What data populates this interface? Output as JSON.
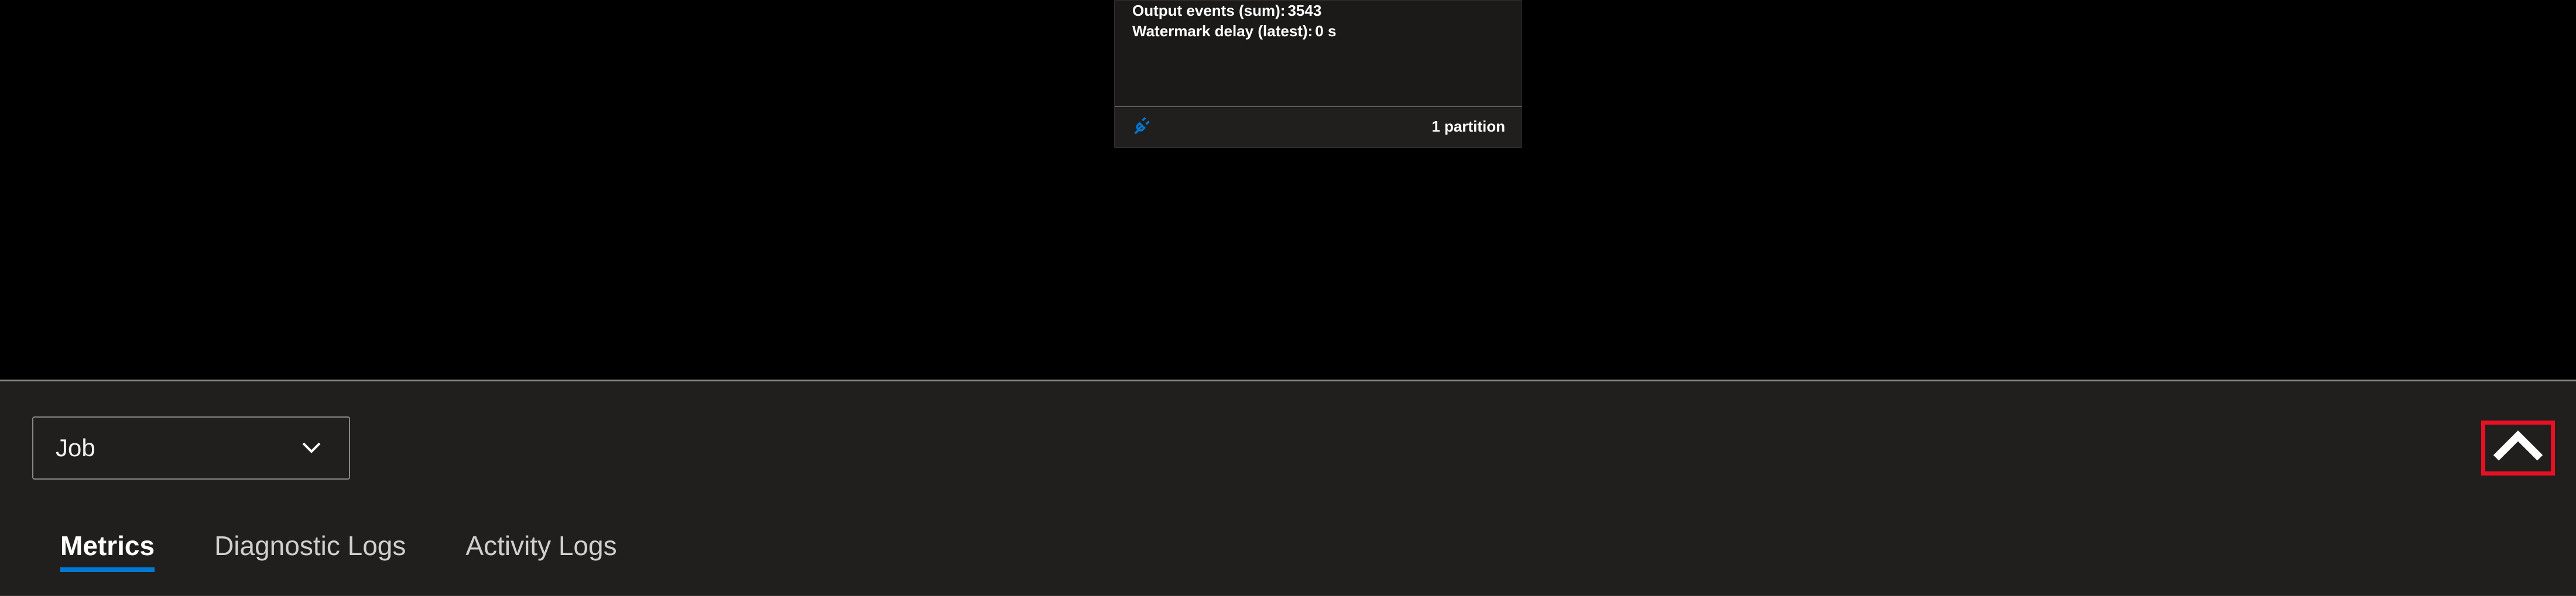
{
  "node": {
    "stats": [
      {
        "label": "Output events (sum):",
        "value": "3543"
      },
      {
        "label": "Watermark delay (latest):",
        "value": "0 s"
      }
    ],
    "footer_text": "1 partition"
  },
  "panel": {
    "select_value": "Job",
    "tabs": [
      {
        "label": "Metrics",
        "active": true
      },
      {
        "label": "Diagnostic Logs",
        "active": false
      },
      {
        "label": "Activity Logs",
        "active": false
      }
    ]
  }
}
